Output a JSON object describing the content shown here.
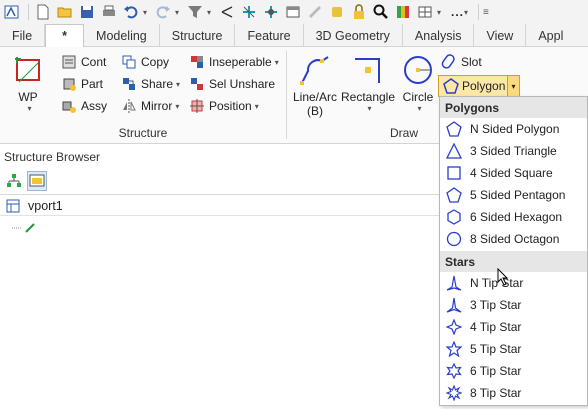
{
  "quick_access": {
    "icons": [
      "app-menu-icon",
      "new-file-icon",
      "open-folder-icon",
      "save-icon",
      "print-icon",
      "undo-icon",
      "redo-icon",
      "filter-icon",
      "point-icon",
      "snap-icon",
      "snap-tool-icon",
      "window-icon",
      "tape-icon",
      "paint-icon",
      "lock-icon",
      "zoom-icon",
      "color-icon",
      "layout-icon"
    ],
    "more_label": "..."
  },
  "tabs": [
    "File",
    "*",
    "Modeling",
    "Structure",
    "Feature",
    "3D Geometry",
    "Analysis",
    "View",
    "Appl"
  ],
  "active_tab_index": 1,
  "ribbon": {
    "wp_label": "WP",
    "structure_group": {
      "label": "Structure",
      "col1": [
        "Cont",
        "Part",
        "Assy"
      ],
      "col2": [
        "Copy",
        "Share",
        "Mirror"
      ],
      "col3": [
        "Inseperable",
        "Sel Unshare",
        "Position"
      ]
    },
    "draw_group": {
      "label": "Draw",
      "line_arc_line1": "Line/Arc",
      "line_arc_line2": "(B)",
      "rectangle": "Rectangle",
      "circle": "Circle",
      "slot": "Slot",
      "polygon": "Polygon"
    }
  },
  "structure_browser": {
    "title": "Structure Browser",
    "vport": "vport1"
  },
  "polygon_menu": {
    "polygons_header": "Polygons",
    "polygons": [
      "N Sided Polygon",
      "3 Sided Triangle",
      "4 Sided Square",
      "5 Sided Pentagon",
      "6 Sided Hexagon",
      "8 Sided Octagon"
    ],
    "stars_header": "Stars",
    "stars": [
      "N Tip Star",
      "3 Tip Star",
      "4 Tip Star",
      "5 Tip Star",
      "6 Tip Star",
      "8 Tip Star"
    ]
  },
  "colors": {
    "accent_blue": "#2a3fc8",
    "polygon_highlight": "#fde7a6",
    "polygon_border": "#c9a227"
  }
}
